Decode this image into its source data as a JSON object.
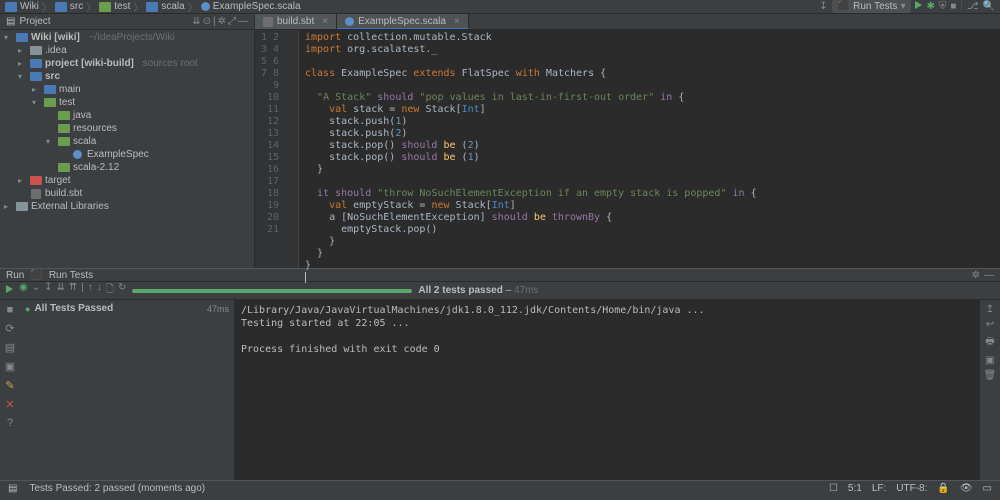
{
  "breadcrumb": [
    "Wiki",
    "src",
    "test",
    "scala",
    "ExampleSpec.scala"
  ],
  "runConfig": "Run Tests",
  "project": {
    "label": "Project",
    "root": {
      "name": "Wiki [wiki]",
      "path": "~/IdeaProjects/Wiki"
    },
    "nodes": [
      ".idea",
      "project [wiki-build]",
      "sources root",
      "src",
      "main",
      "java",
      "resources",
      "scala",
      "ExampleSpec",
      "scala-2.12",
      "target",
      "build.sbt",
      "External Libraries"
    ]
  },
  "tabs": [
    {
      "label": "build.sbt",
      "active": false
    },
    {
      "label": "ExampleSpec.scala",
      "active": true
    }
  ],
  "code": {
    "lines": [
      1,
      2,
      3,
      4,
      5,
      6,
      7,
      8,
      9,
      10,
      11,
      12,
      13,
      14,
      15,
      16,
      17,
      18,
      19,
      20,
      21
    ]
  },
  "tool": {
    "run": "Run",
    "name": "Run Tests"
  },
  "tests": {
    "summary": "All 2 tests passed",
    "time": "47ms",
    "root": {
      "label": "All Tests Passed",
      "ms": "47ms"
    }
  },
  "console": {
    "l1": "/Library/Java/JavaVirtualMachines/jdk1.8.0_112.jdk/Contents/Home/bin/java ...",
    "l2": "Testing started at 22:05 ...",
    "l3": "Process finished with exit code 0"
  },
  "status": {
    "msg": "Tests Passed: 2 passed (moments ago)",
    "pos": "5:1",
    "lf": "LF:",
    "enc": "UTF-8:"
  }
}
